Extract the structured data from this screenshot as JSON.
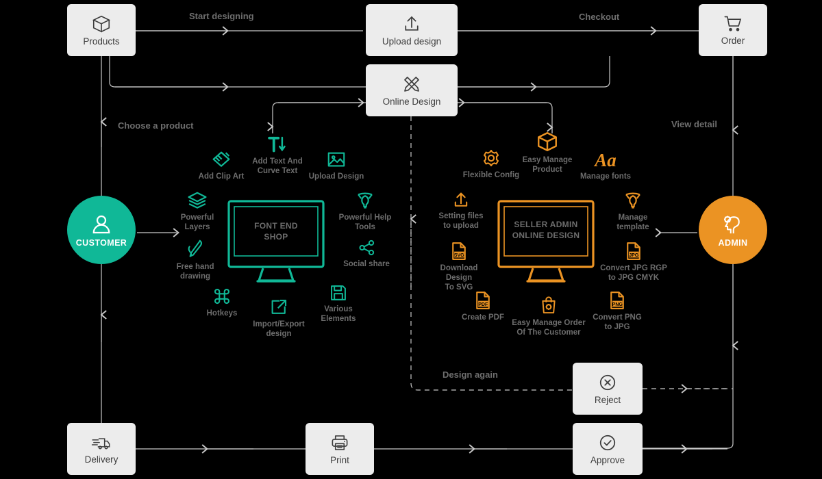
{
  "theme": {
    "background": "#000000",
    "node_bg": "#ececec",
    "node_text": "#3d3d3d",
    "wire": "#c9c9c9",
    "customer_color": "#10b897",
    "admin_color": "#eb9323",
    "feature_text": "#6d6d6d"
  },
  "nodes": {
    "products": {
      "label": "Products",
      "icon": "box-icon"
    },
    "upload_design": {
      "label": "Upload design",
      "icon": "upload-icon"
    },
    "online_design": {
      "label": "Online Design",
      "icon": "pencil-ruler-icon"
    },
    "order": {
      "label": "Order",
      "icon": "shopping-cart-icon"
    },
    "reject": {
      "label": "Reject",
      "icon": "circle-x-icon"
    },
    "approve": {
      "label": "Approve",
      "icon": "circle-check-icon"
    },
    "print": {
      "label": "Print",
      "icon": "printer-icon"
    },
    "delivery": {
      "label": "Delivery",
      "icon": "truck-icon"
    }
  },
  "actors": {
    "customer": {
      "label": "CUSTOMER",
      "icon": "user-icon",
      "color": "#10b897"
    },
    "admin": {
      "label": "ADMIN",
      "icon": "brain-gear-icon",
      "color": "#eb9323"
    }
  },
  "edge_labels": {
    "start_designing": "Start designing",
    "checkout": "Checkout",
    "choose_a_product": "Choose a product",
    "view_detail": "View detail",
    "design_again": "Design again"
  },
  "front_end": {
    "screen_text": "FONT END\nSHOP",
    "color": "#10b897",
    "features": [
      {
        "label": "Add Clip Art",
        "icon": "clip-art-icon"
      },
      {
        "label": "Add Text And\nCurve Text",
        "icon": "curve-text-icon"
      },
      {
        "label": "Upload Design",
        "icon": "image-icon"
      },
      {
        "label": "Powerful\nLayers",
        "icon": "layers-icon"
      },
      {
        "label": "Free hand\ndrawing",
        "icon": "pen-icon"
      },
      {
        "label": "Hotkeys",
        "icon": "command-icon"
      },
      {
        "label": "Import/Export\ndesign",
        "icon": "export-icon"
      },
      {
        "label": "Various\nElements",
        "icon": "floppy-icon"
      },
      {
        "label": "Social share",
        "icon": "share-icon"
      },
      {
        "label": "Powerful Help\nTools",
        "icon": "help-tools-icon"
      }
    ]
  },
  "seller_admin": {
    "screen_text": "SELLER ADMIN\nONLINE DESIGN",
    "color": "#eb9323",
    "features": [
      {
        "label": "Flexible Config",
        "icon": "gear-icon"
      },
      {
        "label": "Easy Manage\nProduct",
        "icon": "box-icon"
      },
      {
        "label": "Manage fonts",
        "icon": "font-aa-icon"
      },
      {
        "label": "Setting files\nto upload",
        "icon": "upload-icon"
      },
      {
        "label": "Download Design\nTo SVG",
        "icon": "file-svg-icon"
      },
      {
        "label": "Create PDF",
        "icon": "file-pdf-icon"
      },
      {
        "label": "Easy Manage Order\nOf The Customer",
        "icon": "shopping-bag-icon"
      },
      {
        "label": "Convert PNG\nto JPG",
        "icon": "file-png-icon"
      },
      {
        "label": "Convert JPG RGP\nto JPG CMYK",
        "icon": "file-jpg-icon"
      },
      {
        "label": "Manage\ntemplate",
        "icon": "help-tools-icon"
      }
    ]
  }
}
